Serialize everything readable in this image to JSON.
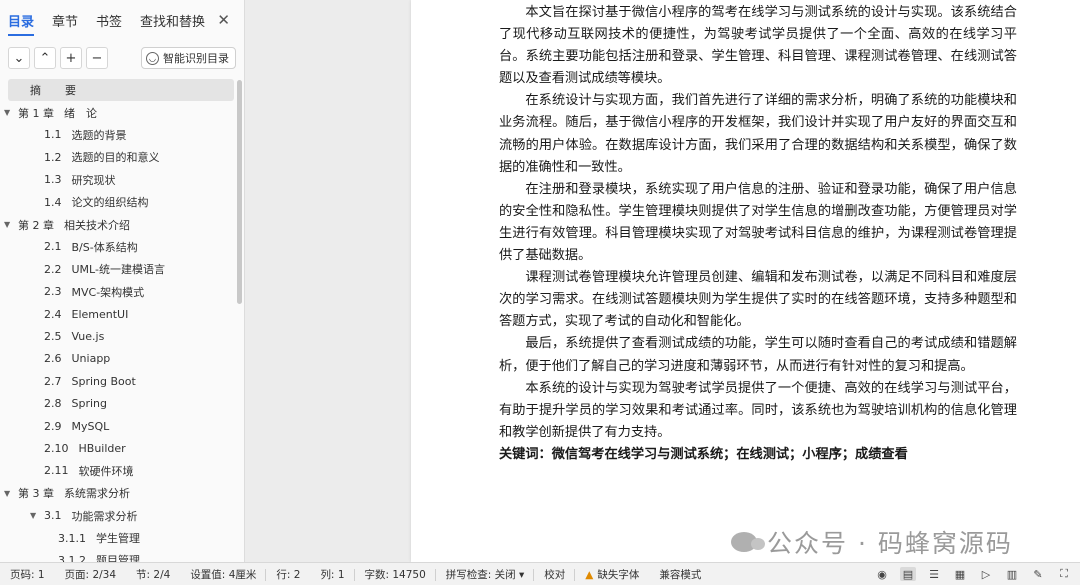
{
  "nav_tabs": [
    "目录",
    "章节",
    "书签",
    "查找和替换"
  ],
  "toolbar": {
    "smart_label": "智能识别目录"
  },
  "toc": [
    {
      "num": "摘",
      "title": "要",
      "level": 0,
      "arrow": ""
    },
    {
      "num": "第 1 章",
      "title": "绪　论",
      "level": 1,
      "arrow": "▼"
    },
    {
      "num": "1.1",
      "title": "选题的背景",
      "level": 2,
      "arrow": ""
    },
    {
      "num": "1.2",
      "title": "选题的目的和意义",
      "level": 2,
      "arrow": ""
    },
    {
      "num": "1.3",
      "title": "研究现状",
      "level": 2,
      "arrow": ""
    },
    {
      "num": "1.4",
      "title": "论文的组织结构",
      "level": 2,
      "arrow": ""
    },
    {
      "num": "第 2 章",
      "title": "相关技术介绍",
      "level": 1,
      "arrow": "▼"
    },
    {
      "num": "2.1",
      "title": "B/S-体系结构",
      "level": 2,
      "arrow": ""
    },
    {
      "num": "2.2",
      "title": "UML-统一建模语言",
      "level": 2,
      "arrow": ""
    },
    {
      "num": "2.3",
      "title": "MVC-架构模式",
      "level": 2,
      "arrow": ""
    },
    {
      "num": "2.4",
      "title": "ElementUI",
      "level": 2,
      "arrow": ""
    },
    {
      "num": "2.5",
      "title": "Vue.js",
      "level": 2,
      "arrow": ""
    },
    {
      "num": "2.6",
      "title": "Uniapp",
      "level": 2,
      "arrow": ""
    },
    {
      "num": "2.7",
      "title": "Spring Boot",
      "level": 2,
      "arrow": ""
    },
    {
      "num": "2.8",
      "title": "Spring",
      "level": 2,
      "arrow": ""
    },
    {
      "num": "2.9",
      "title": "MySQL",
      "level": 2,
      "arrow": ""
    },
    {
      "num": "2.10",
      "title": "HBuilder",
      "level": 2,
      "arrow": ""
    },
    {
      "num": "2.11",
      "title": "软硬件环境",
      "level": 2,
      "arrow": ""
    },
    {
      "num": "第 3 章",
      "title": "系统需求分析",
      "level": 1,
      "arrow": "▼"
    },
    {
      "num": "3.1",
      "title": "功能需求分析",
      "level": 2,
      "arrow": "▼"
    },
    {
      "num": "3.1.1",
      "title": "学生管理",
      "level": 3,
      "arrow": ""
    },
    {
      "num": "3.1.2",
      "title": "题目管理",
      "level": 3,
      "arrow": ""
    }
  ],
  "document": {
    "paragraphs": [
      "本文旨在探讨基于微信小程序的驾考在线学习与测试系统的设计与实现。该系统结合了现代移动互联网技术的便捷性，为驾驶考试学员提供了一个全面、高效的在线学习平台。系统主要功能包括注册和登录、学生管理、科目管理、课程测试卷管理、在线测试答题以及查看测试成绩等模块。",
      "在系统设计与实现方面，我们首先进行了详细的需求分析，明确了系统的功能模块和业务流程。随后，基于微信小程序的开发框架，我们设计并实现了用户友好的界面交互和流畅的用户体验。在数据库设计方面，我们采用了合理的数据结构和关系模型，确保了数据的准确性和一致性。",
      "在注册和登录模块，系统实现了用户信息的注册、验证和登录功能，确保了用户信息的安全性和隐私性。学生管理模块则提供了对学生信息的增删改查功能，方便管理员对学生进行有效管理。科目管理模块实现了对驾驶考试科目信息的维护，为课程测试卷管理提供了基础数据。",
      "课程测试卷管理模块允许管理员创建、编辑和发布测试卷，以满足不同科目和难度层次的学习需求。在线测试答题模块则为学生提供了实时的在线答题环境，支持多种题型和答题方式，实现了考试的自动化和智能化。",
      "最后，系统提供了查看测试成绩的功能，学生可以随时查看自己的考试成绩和错题解析，便于他们了解自己的学习进度和薄弱环节，从而进行有针对性的复习和提高。",
      "本系统的设计与实现为驾驶考试学员提供了一个便捷、高效的在线学习与测试平台，有助于提升学员的学习效果和考试通过率。同时，该系统也为驾驶培训机构的信息化管理和教学创新提供了有力支持。"
    ],
    "keywords": "关键词：微信驾考在线学习与测试系统；在线测试；小程序；成绩查看"
  },
  "watermark": "公众号 · 码蜂窝源码",
  "status": [
    {
      "label": "页码: 1"
    },
    {
      "label": "页面: 2/34"
    },
    {
      "label": "节: 2/4"
    },
    {
      "label": "设置值: 4厘米"
    },
    {
      "label": "行: 2"
    },
    {
      "label": "列: 1"
    },
    {
      "label": "字数: 14750"
    },
    {
      "label": "拼写检查: 关闭 ▾"
    },
    {
      "label": "校对"
    },
    {
      "label": "缺失字体"
    },
    {
      "label": "兼容模式"
    }
  ]
}
